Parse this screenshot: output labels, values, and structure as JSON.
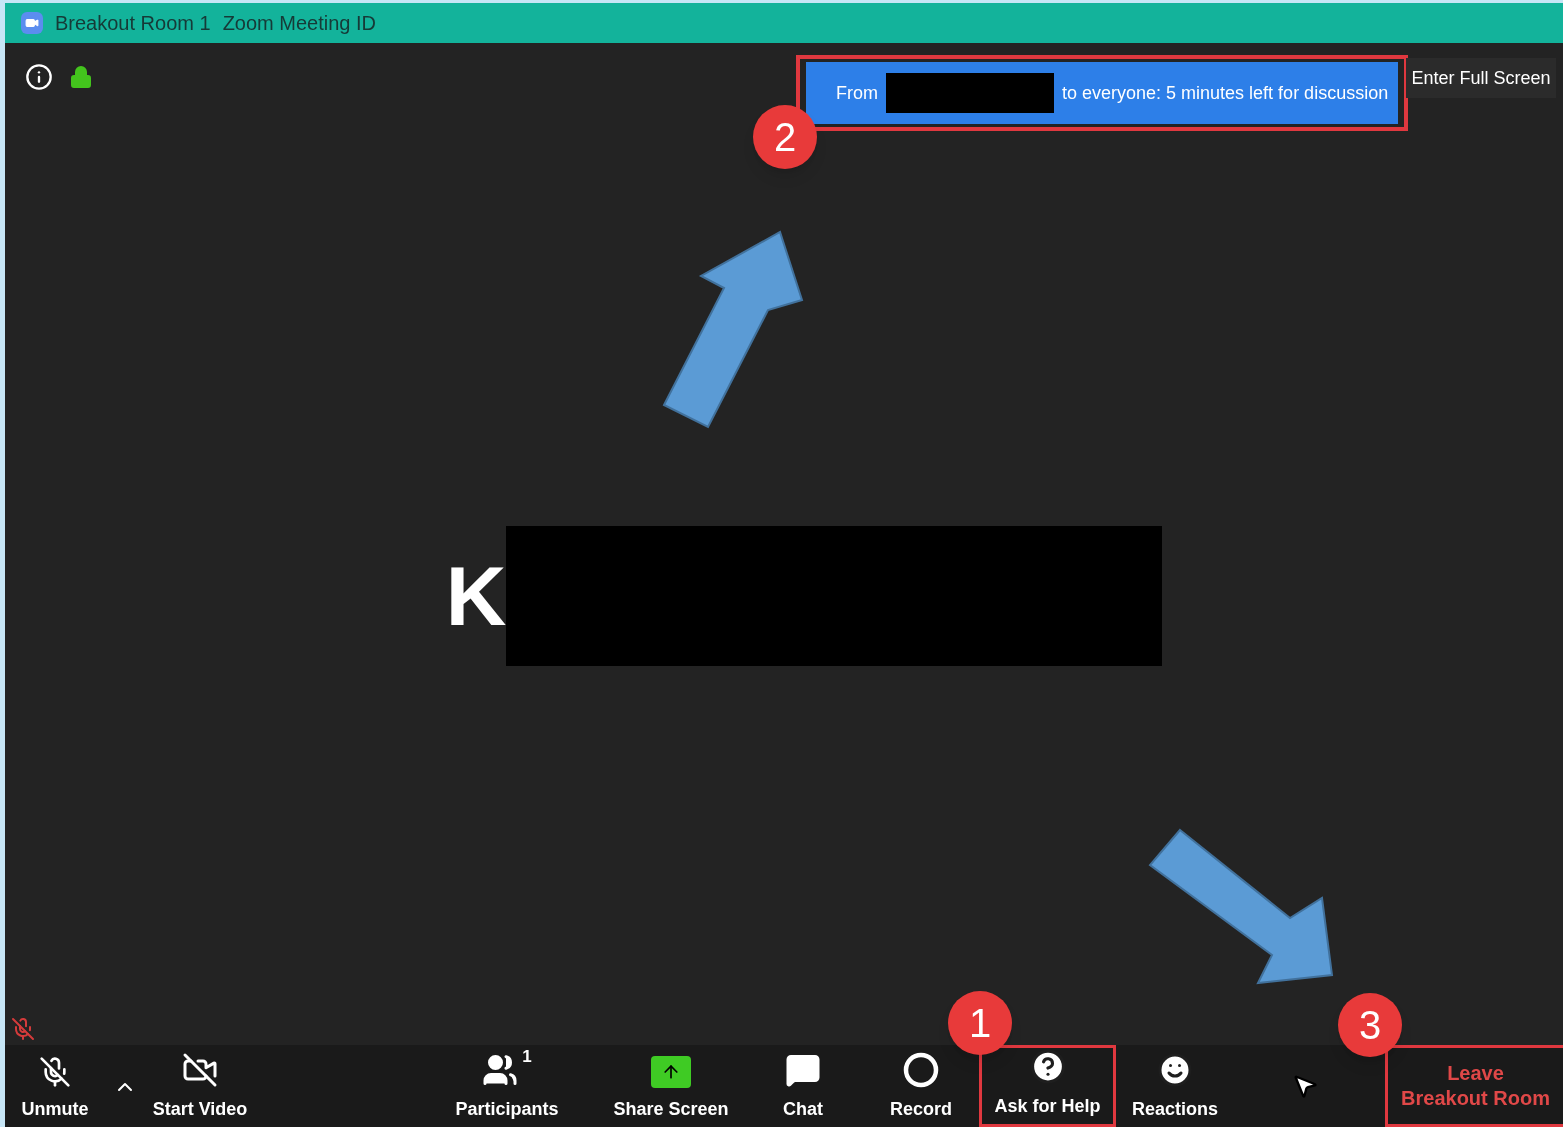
{
  "window": {
    "title": "Breakout Room 1",
    "meeting_label": "Zoom Meeting ID"
  },
  "top_bar": {
    "full_screen": "Enter Full Screen"
  },
  "notification": {
    "prefix": "From",
    "text": "to everyone: 5 minutes left for discussion"
  },
  "participant": {
    "initial": "K"
  },
  "toolbar": {
    "items": [
      {
        "kind": "mic",
        "label": "Unmute",
        "muted": true
      },
      {
        "kind": "caret"
      },
      {
        "kind": "video",
        "label": "Start Video",
        "off": true
      },
      {
        "kind": "participants",
        "label": "Participants",
        "count": "1"
      },
      {
        "kind": "share",
        "label": "Share Screen"
      },
      {
        "kind": "chat",
        "label": "Chat"
      },
      {
        "kind": "record",
        "label": "Record"
      },
      {
        "kind": "help",
        "label": "Ask for Help"
      },
      {
        "kind": "reactions",
        "label": "Reactions"
      }
    ],
    "leave_button": [
      "Leave",
      "Breakout Room"
    ]
  },
  "annotations": [
    {
      "number": "1"
    },
    {
      "number": "2"
    },
    {
      "number": "3"
    }
  ]
}
